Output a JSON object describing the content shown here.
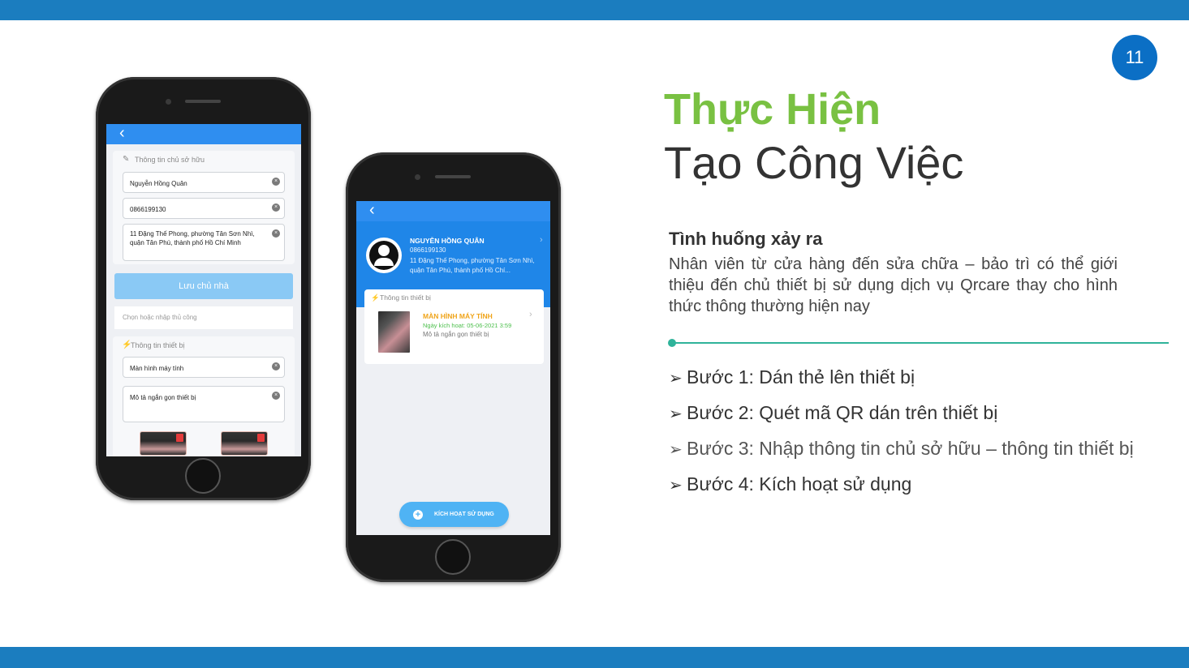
{
  "slide": {
    "page_number": "11",
    "title_line1": "Thực Hiện",
    "title_line2": "Tạo Công Việc",
    "situation_heading": "Tình huống xảy ra",
    "situation_body": "Nhân viên từ cửa hàng đến sửa chữa – bảo trì có thể giới thiệu đến chủ thiết bị sử dụng dịch vụ Qrcare thay cho hình thức thông thường hiện nay",
    "steps": [
      "Bước 1: Dán thẻ lên thiết bị",
      "Bước 2: Quét mã QR dán trên thiết bị",
      "Bước 3: Nhập thông tin chủ sở hữu – thông tin thiết bị",
      "Bước 4: Kích hoạt sử dụng"
    ],
    "step_arrow": "➢"
  },
  "phone1": {
    "back": "‹",
    "owner_section": "Thông tin chủ sở hữu",
    "owner_name": "Nguyễn Hồng Quân",
    "owner_phone": "0866199130",
    "owner_address": "11 Đặng Thế Phong, phường Tân Sơn Nhì, quận Tân Phú, thành phố Hồ Chí Minh",
    "save_button": "Lưu chủ nhà",
    "manual_picker": "Chọn hoặc nhập thủ công",
    "device_section": "Thông tin thiết bị",
    "device_name": "Màn hình máy tính",
    "device_desc": "Mô tả ngắn gọn thiết bị",
    "clear_icon": "×"
  },
  "phone2": {
    "back": "‹",
    "owner_name": "NGUYỄN HỒNG QUÂN",
    "owner_phone": "0866199130",
    "owner_address": "11 Đặng Thế Phong, phường Tân Sơn Nhì, quận Tân Phú, thành phố Hồ Chí...",
    "device_section": "Thông tin thiết bị",
    "device_name": "MÀN HÌNH MÁY TÍNH",
    "device_date": "Ngày kích hoạt: 05-06-2021 3:59",
    "device_desc": "Mô tả ngắn gọn thiết bị",
    "activate_button": "KÍCH HOẠT SỬ DỤNG",
    "plus": "+",
    "chevron": "›"
  },
  "colors": {
    "brand_blue": "#1b7dbf",
    "title_green": "#79c142",
    "divider_teal": "#2fb39a"
  }
}
